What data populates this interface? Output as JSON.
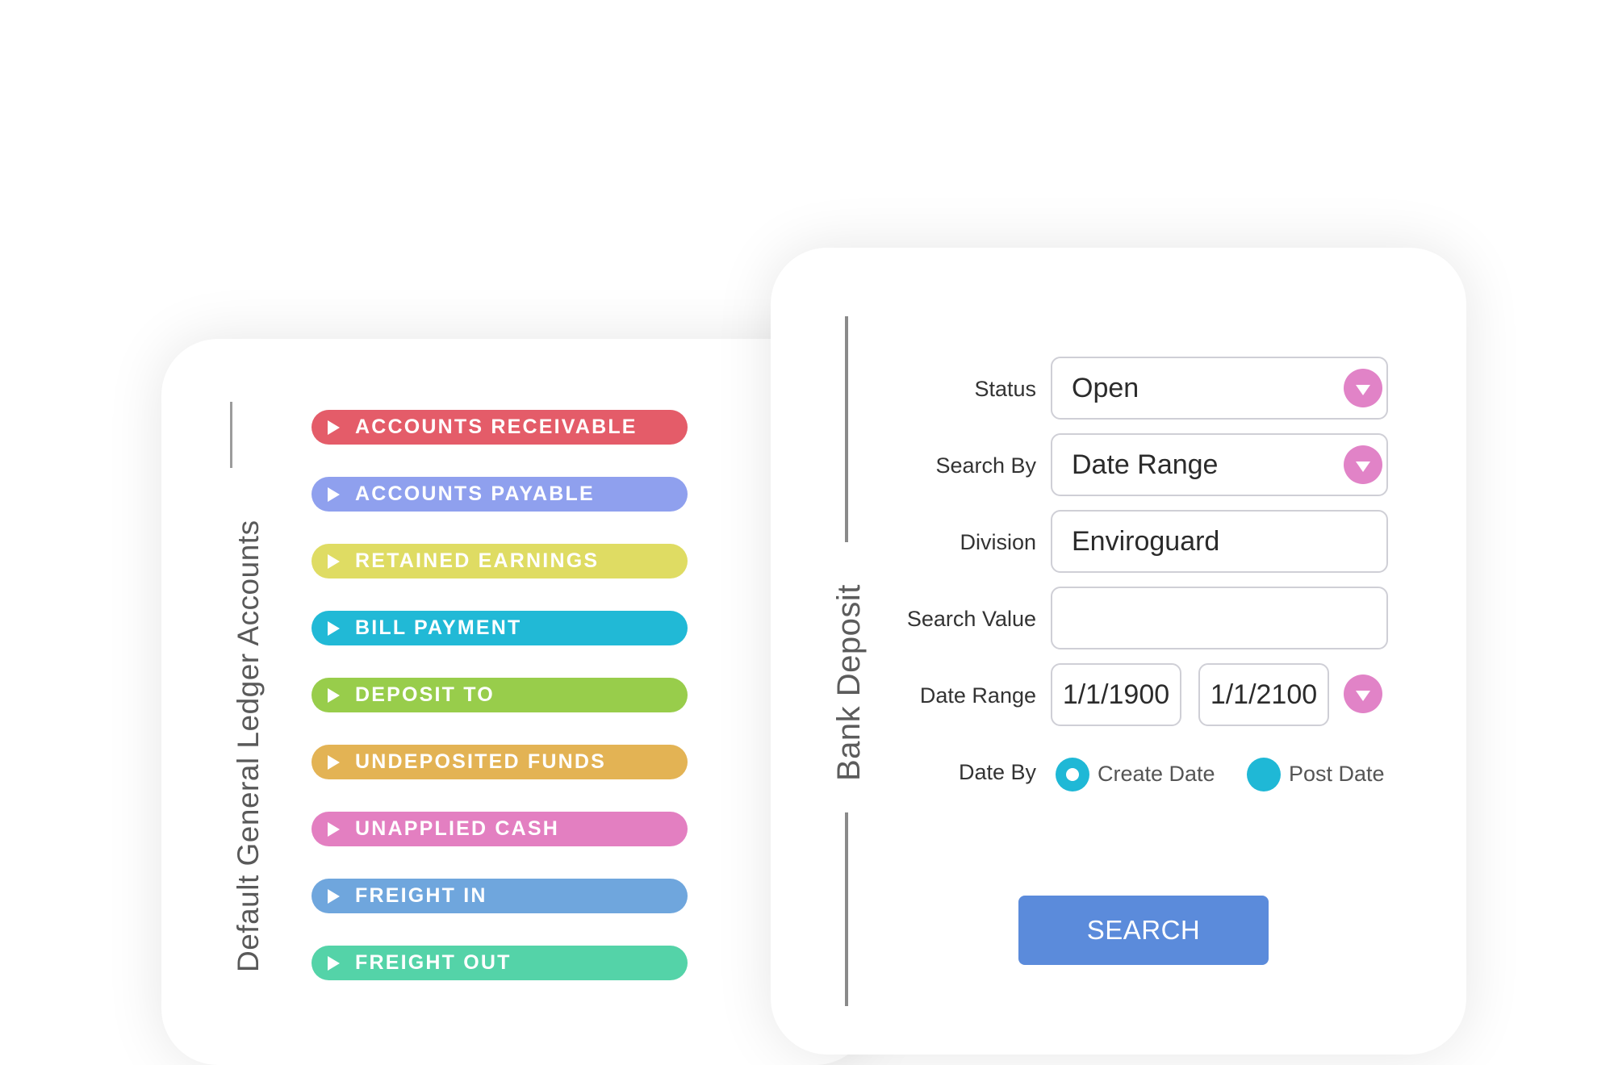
{
  "gl_panel": {
    "title": "Default General Ledger Accounts",
    "items": [
      {
        "label": "ACCOUNTS RECEIVABLE",
        "color": "#e45c69"
      },
      {
        "label": "ACCOUNTS PAYABLE",
        "color": "#8fa0ee"
      },
      {
        "label": "RETAINED EARNINGS",
        "color": "#dfdc63"
      },
      {
        "label": "BILL PAYMENT",
        "color": "#21b9d6"
      },
      {
        "label": "DEPOSIT TO",
        "color": "#98cd4b"
      },
      {
        "label": "UNDEPOSITED FUNDS",
        "color": "#e3b354"
      },
      {
        "label": "UNAPPLIED CASH",
        "color": "#e37fc1"
      },
      {
        "label": "FREIGHT IN",
        "color": "#6fa6dd"
      },
      {
        "label": "FREIGHT OUT",
        "color": "#54d3a8"
      }
    ]
  },
  "deposit_panel": {
    "title": "Bank Deposit",
    "status": {
      "label": "Status",
      "value": "Open"
    },
    "search_by": {
      "label": "Search By",
      "value": "Date Range"
    },
    "division": {
      "label": "Division",
      "value": "Enviroguard"
    },
    "search_value": {
      "label": "Search Value",
      "value": ""
    },
    "date_range": {
      "label": "Date Range",
      "start": "1/1/1900",
      "end": "1/1/2100"
    },
    "date_by": {
      "label": "Date By",
      "options": [
        "Create Date",
        "Post Date"
      ],
      "selected": "Create Date"
    },
    "search_button": "SEARCH",
    "colors": {
      "dropdown_accent": "#e183c7",
      "radio_accent": "#1fb8d6",
      "button": "#5b8bdb"
    },
    "icons": {
      "dropdown": "chevron-down-icon",
      "list_marker": "play-triangle-icon"
    }
  }
}
